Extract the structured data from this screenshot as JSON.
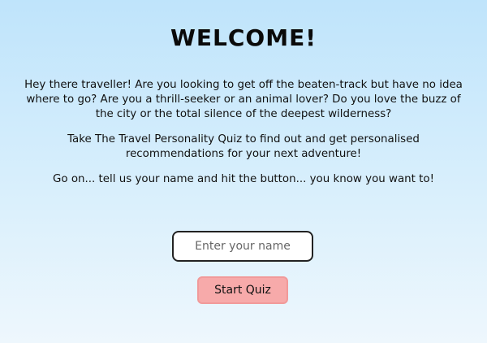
{
  "header": {
    "title": "WELCOME!"
  },
  "intro": {
    "paragraph1": "Hey there traveller! Are you looking to get off the beaten-track but have no idea where to go? Are you a thrill-seeker or an animal lover? Do you love the buzz of the city or the total silence of the deepest wilderness?",
    "paragraph2": "Take The Travel Personality Quiz to find out and get personalised recommendations for your next adventure!",
    "paragraph3": "Go on... tell us your name and hit the button... you know you want to!"
  },
  "form": {
    "name_placeholder": "Enter your name",
    "name_value": "",
    "start_label": "Start Quiz"
  },
  "colors": {
    "background_top": "#bfe4fb",
    "background_bottom": "#eef7fd",
    "button_fill": "#f7aaaa",
    "button_border": "#f19a9a"
  }
}
